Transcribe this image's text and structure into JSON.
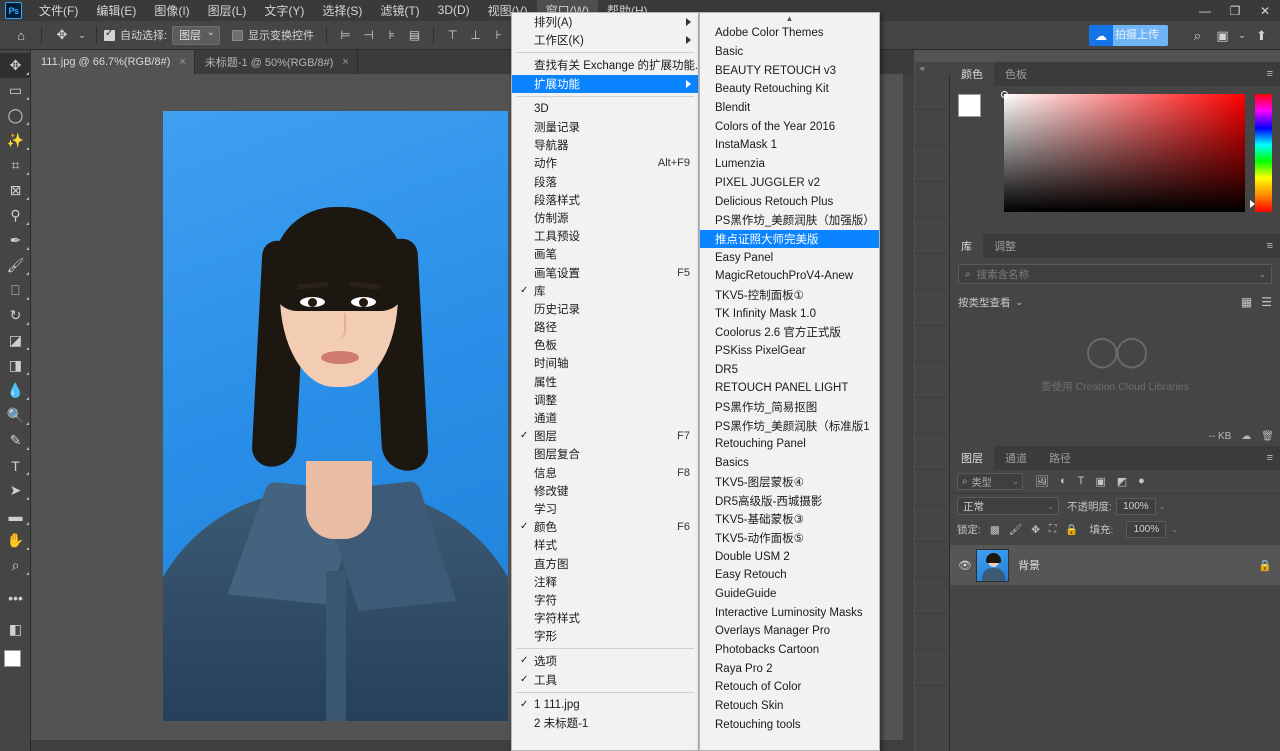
{
  "app": {
    "logo": "Ps",
    "window_controls": [
      "minimize",
      "restore",
      "close"
    ]
  },
  "menubar": {
    "items": [
      {
        "label": "文件(F)",
        "active": false
      },
      {
        "label": "编辑(E)",
        "active": false
      },
      {
        "label": "图像(I)",
        "active": false
      },
      {
        "label": "图层(L)",
        "active": false
      },
      {
        "label": "文字(Y)",
        "active": false
      },
      {
        "label": "选择(S)",
        "active": false
      },
      {
        "label": "滤镜(T)",
        "active": false
      },
      {
        "label": "3D(D)",
        "active": false
      },
      {
        "label": "视图(V)",
        "active": false
      },
      {
        "label": "窗口(W)",
        "active": true
      },
      {
        "label": "帮助(H)",
        "active": false
      }
    ]
  },
  "options_bar": {
    "home_icon": "home-icon",
    "tool_icon": "move-tool-icon",
    "auto_select_label": "自动选择:",
    "auto_select_checked": true,
    "layer_select_value": "图层",
    "show_transform_label": "显示变换控件",
    "show_transform_checked": false,
    "align_icons": [
      "align-left",
      "align-center-h",
      "align-right",
      "distribute-h",
      "align-top",
      "align-middle",
      "align-bottom"
    ],
    "cc_button_label": "拍摄上传",
    "cc_icon": "cloud-icon",
    "right_icons": [
      "search-icon",
      "workspace-icon",
      "chevron-down-icon",
      "share-icon"
    ]
  },
  "tabs": [
    {
      "label": "111.jpg @ 66.7%(RGB/8#)",
      "active": true,
      "close": "×"
    },
    {
      "label": "未标题-1 @ 50%(RGB/8#)",
      "active": false,
      "close": "×"
    }
  ],
  "toolbar": {
    "tools": [
      {
        "name": "move-tool",
        "glyph": "✥",
        "selected": true
      },
      {
        "name": "marquee-tool",
        "glyph": "▭",
        "selected": false
      },
      {
        "name": "lasso-tool",
        "glyph": "◯",
        "selected": false
      },
      {
        "name": "quick-selection-tool",
        "glyph": "✨",
        "selected": false
      },
      {
        "name": "crop-tool",
        "glyph": "⌗",
        "selected": false
      },
      {
        "name": "frame-tool",
        "glyph": "⊠",
        "selected": false
      },
      {
        "name": "eyedropper-tool",
        "glyph": "⚲",
        "selected": false
      },
      {
        "name": "healing-brush-tool",
        "glyph": "✒",
        "selected": false
      },
      {
        "name": "brush-tool",
        "glyph": "🖌",
        "selected": false
      },
      {
        "name": "clone-stamp-tool",
        "glyph": "⎕",
        "selected": false
      },
      {
        "name": "history-brush-tool",
        "glyph": "↻",
        "selected": false
      },
      {
        "name": "eraser-tool",
        "glyph": "◪",
        "selected": false
      },
      {
        "name": "gradient-tool",
        "glyph": "◨",
        "selected": false
      },
      {
        "name": "blur-tool",
        "glyph": "💧",
        "selected": false
      },
      {
        "name": "dodge-tool",
        "glyph": "🔍",
        "selected": false
      },
      {
        "name": "pen-tool",
        "glyph": "✎",
        "selected": false
      },
      {
        "name": "type-tool",
        "glyph": "T",
        "selected": false
      },
      {
        "name": "path-selection-tool",
        "glyph": "➤",
        "selected": false
      },
      {
        "name": "rectangle-tool",
        "glyph": "▬",
        "selected": false
      },
      {
        "name": "hand-tool",
        "glyph": "✋",
        "selected": false
      },
      {
        "name": "zoom-tool",
        "glyph": "⌕",
        "selected": false
      },
      {
        "name": "edit-toolbar",
        "glyph": "•••",
        "selected": false
      },
      {
        "name": "quick-mask-toggle",
        "glyph": "◧",
        "selected": false
      }
    ],
    "foreground_color": "#ffffff",
    "background_color": "#000000"
  },
  "window_menu": {
    "rows": [
      {
        "label": "排列(A)",
        "submenu": true,
        "checked": false,
        "accel": ""
      },
      {
        "label": "工作区(K)",
        "submenu": true,
        "checked": false,
        "accel": ""
      },
      {
        "sep": true
      },
      {
        "label": "查找有关 Exchange 的扩展功能...",
        "submenu": false,
        "checked": false,
        "accel": ""
      },
      {
        "label": "扩展功能",
        "submenu": true,
        "checked": false,
        "accel": "",
        "highlight": true
      },
      {
        "sep": true
      },
      {
        "label": "3D",
        "submenu": false,
        "checked": false,
        "accel": ""
      },
      {
        "label": "测量记录",
        "submenu": false,
        "checked": false,
        "accel": ""
      },
      {
        "label": "导航器",
        "submenu": false,
        "checked": false,
        "accel": ""
      },
      {
        "label": "动作",
        "submenu": false,
        "checked": false,
        "accel": "Alt+F9"
      },
      {
        "label": "段落",
        "submenu": false,
        "checked": false,
        "accel": ""
      },
      {
        "label": "段落样式",
        "submenu": false,
        "checked": false,
        "accel": ""
      },
      {
        "label": "仿制源",
        "submenu": false,
        "checked": false,
        "accel": ""
      },
      {
        "label": "工具预设",
        "submenu": false,
        "checked": false,
        "accel": ""
      },
      {
        "label": "画笔",
        "submenu": false,
        "checked": false,
        "accel": ""
      },
      {
        "label": "画笔设置",
        "submenu": false,
        "checked": false,
        "accel": "F5"
      },
      {
        "label": "库",
        "submenu": false,
        "checked": true,
        "accel": ""
      },
      {
        "label": "历史记录",
        "submenu": false,
        "checked": false,
        "accel": ""
      },
      {
        "label": "路径",
        "submenu": false,
        "checked": false,
        "accel": ""
      },
      {
        "label": "色板",
        "submenu": false,
        "checked": false,
        "accel": ""
      },
      {
        "label": "时间轴",
        "submenu": false,
        "checked": false,
        "accel": ""
      },
      {
        "label": "属性",
        "submenu": false,
        "checked": false,
        "accel": ""
      },
      {
        "label": "调整",
        "submenu": false,
        "checked": false,
        "accel": ""
      },
      {
        "label": "通道",
        "submenu": false,
        "checked": false,
        "accel": ""
      },
      {
        "label": "图层",
        "submenu": false,
        "checked": true,
        "accel": "F7"
      },
      {
        "label": "图层复合",
        "submenu": false,
        "checked": false,
        "accel": ""
      },
      {
        "label": "信息",
        "submenu": false,
        "checked": false,
        "accel": "F8"
      },
      {
        "label": "修改键",
        "submenu": false,
        "checked": false,
        "accel": ""
      },
      {
        "label": "学习",
        "submenu": false,
        "checked": false,
        "accel": ""
      },
      {
        "label": "颜色",
        "submenu": false,
        "checked": true,
        "accel": "F6"
      },
      {
        "label": "样式",
        "submenu": false,
        "checked": false,
        "accel": ""
      },
      {
        "label": "直方图",
        "submenu": false,
        "checked": false,
        "accel": ""
      },
      {
        "label": "注释",
        "submenu": false,
        "checked": false,
        "accel": ""
      },
      {
        "label": "字符",
        "submenu": false,
        "checked": false,
        "accel": ""
      },
      {
        "label": "字符样式",
        "submenu": false,
        "checked": false,
        "accel": ""
      },
      {
        "label": "字形",
        "submenu": false,
        "checked": false,
        "accel": ""
      },
      {
        "sep": true
      },
      {
        "label": "选项",
        "submenu": false,
        "checked": true,
        "accel": ""
      },
      {
        "label": "工具",
        "submenu": false,
        "checked": true,
        "accel": ""
      },
      {
        "sep": true
      },
      {
        "label": "1 111.jpg",
        "submenu": false,
        "checked": true,
        "accel": ""
      },
      {
        "label": "2 未标题-1",
        "submenu": false,
        "checked": false,
        "accel": ""
      }
    ]
  },
  "extensions_submenu": {
    "scroll_up_icon": "chevron-up-icon",
    "items": [
      "Adobe Color Themes",
      "Basic",
      "BEAUTY RETOUCH v3",
      "Beauty Retouching Kit",
      "Blendit",
      "Colors of the Year 2016",
      "InstaMask 1",
      "Lumenzia",
      "PIXEL JUGGLER v2",
      "Delicious Retouch Plus",
      "PS黑作坊_美颜润肤（加强版）",
      "推点证照大师完美版",
      "Easy Panel",
      "MagicRetouchProV4-Anew",
      "TKV5-控制面板①",
      "TK Infinity Mask 1.0",
      "Coolorus 2.6 官方正式版",
      "PSKiss PixelGear",
      "DR5",
      "RETOUCH PANEL LIGHT",
      "PS黑作坊_简易抠图",
      "PS黑作坊_美颜润肤（标准版1",
      "Retouching Panel",
      "Basics",
      "TKV5-图层蒙板④",
      "DR5高级版-西城摄影",
      "TKV5-基础蒙板③",
      "TKV5-动作面板⑤",
      "Double USM 2",
      "Easy Retouch",
      "GuideGuide",
      "Interactive Luminosity Masks",
      "Overlays Manager Pro",
      "Photobacks Cartoon",
      "Raya Pro 2",
      "Retouch of Color",
      "Retouch Skin",
      "Retouching tools"
    ],
    "highlighted": "推点证照大师完美版"
  },
  "right_rail": {
    "icons": [
      {
        "name": "history-snapshot-icon",
        "glyph": "↺"
      },
      {
        "name": "play-action-icon",
        "glyph": "▶"
      },
      {
        "name": "adjustment-panel-icon",
        "glyph": "◉"
      },
      {
        "name": "brush-panel-icon",
        "glyph": "🖌"
      },
      {
        "name": "settings-sliders-icon",
        "glyph": "⇄"
      },
      {
        "name": "retouch-tools-icon",
        "glyph": "✕"
      },
      {
        "name": "retouch-pro-icon",
        "glyph": "R"
      },
      {
        "name": "yy-panel-icon",
        "glyph": "YY"
      },
      {
        "name": "portrait-panel-icon",
        "glyph": "👤"
      },
      {
        "name": "swoosh-panel-icon",
        "glyph": "➴"
      },
      {
        "name": "raya-pro-icon",
        "glyph": "RA"
      },
      {
        "name": "dr5-panel-icon",
        "glyph": "DR5"
      },
      {
        "name": "edit-panel-icon",
        "glyph": "✎"
      },
      {
        "name": "retouch-gold-icon",
        "glyph": "✕"
      },
      {
        "name": "rs-panel-icon",
        "glyph": "RS"
      },
      {
        "name": "yinyang-panel-icon",
        "glyph": "☯"
      },
      {
        "name": "blue-panel-icon",
        "glyph": "◎"
      }
    ]
  },
  "color_panel": {
    "tabs": [
      {
        "label": "颜色",
        "active": true
      },
      {
        "label": "色板",
        "active": false
      }
    ],
    "menu_icon": "panel-menu-icon",
    "foreground": "#ffffff",
    "background": "#000000"
  },
  "library_panel": {
    "tabs": [
      {
        "label": "库",
        "active": true
      },
      {
        "label": "调整",
        "active": false
      }
    ],
    "menu_icon": "panel-menu-icon",
    "search_placeholder": "搜索含名称",
    "filter_label": "按类型查看",
    "empty_text": "要使用 Creation Cloud Libraries",
    "size_label": "-- KB",
    "cloud_icon": "cc-libraries-icon",
    "sync_icon": "cloud-sync-icon",
    "delete_icon": "trash-icon"
  },
  "layers_panel": {
    "tabs": [
      {
        "label": "图层",
        "active": true
      },
      {
        "label": "通道",
        "active": false
      },
      {
        "label": "路径",
        "active": false
      }
    ],
    "menu_icon": "panel-menu-icon",
    "kind_filter": "类型",
    "filter_icons": [
      "image-filter-icon",
      "adjustment-filter-icon",
      "type-filter-icon",
      "shape-filter-icon",
      "smart-object-filter-icon",
      "filter-toggle-icon"
    ],
    "blend_mode": "正常",
    "opacity_label": "不透明度:",
    "opacity_value": "100%",
    "lock_label": "锁定:",
    "lock_icons": [
      "lock-transparency-icon",
      "lock-image-icon",
      "lock-position-icon",
      "lock-artboard-icon",
      "lock-all-icon"
    ],
    "fill_label": "填充:",
    "fill_value": "100%",
    "layers": [
      {
        "name": "背景",
        "visible": true,
        "locked": true,
        "selected": true
      }
    ]
  }
}
